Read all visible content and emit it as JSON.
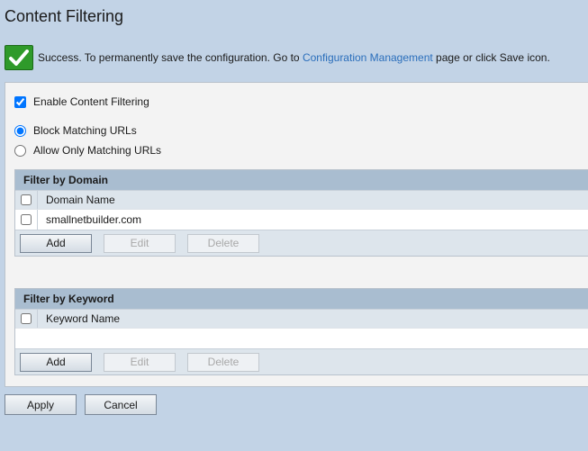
{
  "page": {
    "title": "Content Filtering"
  },
  "success": {
    "prefix": "Success. To permanently save the configuration. Go to ",
    "link": "Configuration Management",
    "suffix": " page or click Save icon."
  },
  "options": {
    "enable_label": "Enable Content Filtering",
    "block_label": "Block Matching URLs",
    "allow_label": "Allow Only Matching URLs"
  },
  "domain": {
    "title": "Filter by Domain",
    "column": "Domain Name",
    "rows": [
      "smallnetbuilder.com"
    ],
    "add": "Add",
    "edit": "Edit",
    "delete": "Delete"
  },
  "keyword": {
    "title": "Filter by Keyword",
    "column": "Keyword Name",
    "add": "Add",
    "edit": "Edit",
    "delete": "Delete"
  },
  "footer": {
    "apply": "Apply",
    "cancel": "Cancel"
  },
  "colors": {
    "background": "#c2d3e6",
    "header": "#a9bdd0",
    "link": "#2a6ebb",
    "success": "#2f9a2a"
  }
}
